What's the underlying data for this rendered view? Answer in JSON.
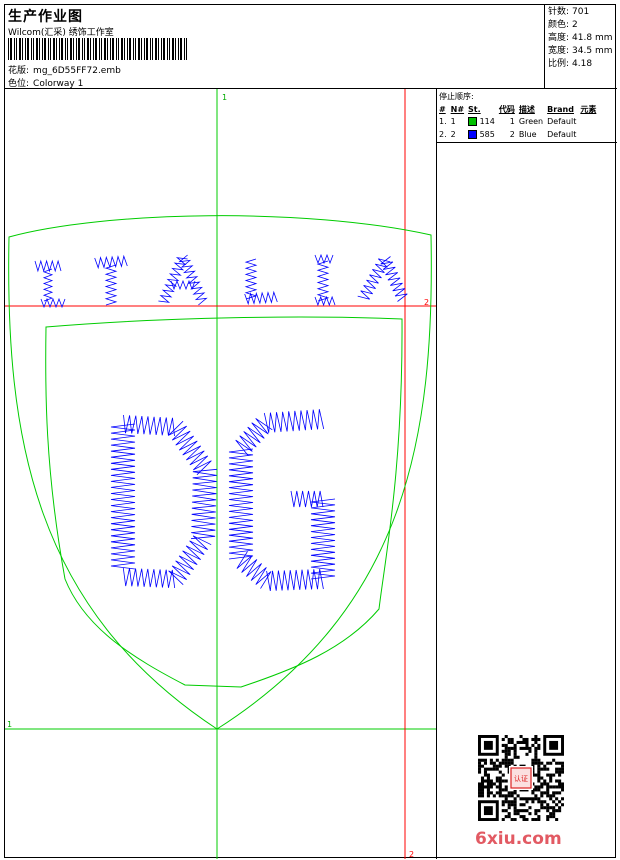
{
  "header": {
    "title": "生产作业图",
    "maker": "Wilcom(汇采) 绣饰工作室",
    "design_label": "花版:",
    "design_value": "mg_6D55FF72.emb",
    "colorway_label": "色位:",
    "colorway_value": "Colorway 1"
  },
  "stats": [
    {
      "label": "针数:",
      "value": "701"
    },
    {
      "label": "颜色:",
      "value": "2"
    },
    {
      "label": "高度:",
      "value": "41.8 mm"
    },
    {
      "label": "宽度:",
      "value": "34.5 mm"
    },
    {
      "label": "比例:",
      "value": "4.18"
    }
  ],
  "stop_sequence": {
    "title": "停止顺序:",
    "headers": [
      "#",
      "N#",
      "St.",
      "代码",
      "描述",
      "Brand",
      "元素"
    ],
    "rows": [
      {
        "index": "1.",
        "n": "1",
        "color": "#00c000",
        "stitches": "114",
        "code": "1",
        "description": "Green",
        "brand": "Default"
      },
      {
        "index": "2.",
        "n": "2",
        "color": "#0000ff",
        "stitches": "585",
        "code": "2",
        "description": "Blue",
        "brand": "Default"
      }
    ]
  },
  "canvas": {
    "markers": {
      "top_v": "1",
      "right_h": "2",
      "left_h": "1",
      "bottom_v": "2"
    },
    "colors": {
      "outline": "#00cc00",
      "thread": "#0000ff",
      "guide_red": "#ff0000",
      "guide_green": "#00cc00"
    },
    "lettering": "ITALIA",
    "monogram": "DG"
  },
  "watermark": {
    "site": "6xiu.com",
    "seal_text": "认证"
  }
}
